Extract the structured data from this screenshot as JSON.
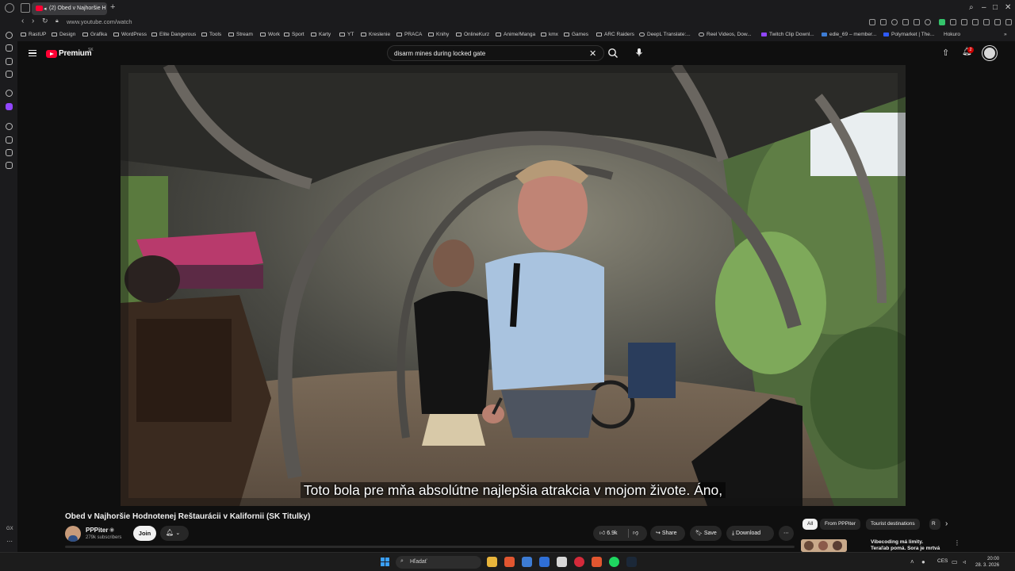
{
  "browser": {
    "active_tab_title": "(2) Obed v Najhoršie H",
    "url": "www.youtube.com/watch",
    "bookmarks": [
      "RastUP",
      "Design",
      "Grafika",
      "WordPress",
      "Elite Dangerous",
      "Tools",
      "Stream",
      "Work",
      "Sport",
      "Karty",
      "YT",
      "Kreslenie",
      "PRACA",
      "Knihy",
      "OnlineKurz",
      "Anime/Manga",
      "kmx",
      "Games",
      "ARC Raiders",
      "DeepL Translate:...",
      "Reel Videos, Dow...",
      "Twitch Clip Downl...",
      "edie_69 – member...",
      "Polymarket | The...",
      "Hokuro"
    ]
  },
  "youtube": {
    "logo_text": "Premium",
    "logo_country": "SK",
    "search_query": "disarm mines during locked gate",
    "notification_count": "2",
    "caption": "Toto bola pre mňa absolútne najlepšia atrakcia v mojom živote. Áno,",
    "video_title": "Obed v Najhoršie Hodnotenej Reštaurácii v Kalifornii (SK Titulky)",
    "channel_name": "PPPiter",
    "subscribers": "279k subscribers",
    "join_label": "Join",
    "like_count": "6.9k",
    "share_label": "Share",
    "save_label": "Save",
    "download_label": "Download",
    "chips": [
      "All",
      "From PPPiter",
      "Tourist destinations",
      "R"
    ],
    "rec_title": "Vibecoding má limity. Teraľab pomá. Sora je mrtvá a vláda"
  },
  "taskbar": {
    "search_placeholder": "Hľadať",
    "lang": "CES",
    "time": "20:00",
    "date": "28. 3. 2026",
    "side_label": "GX"
  },
  "colors": {
    "accent": "#ff0033",
    "background": "#0f0f0f",
    "chip": "#272727"
  }
}
